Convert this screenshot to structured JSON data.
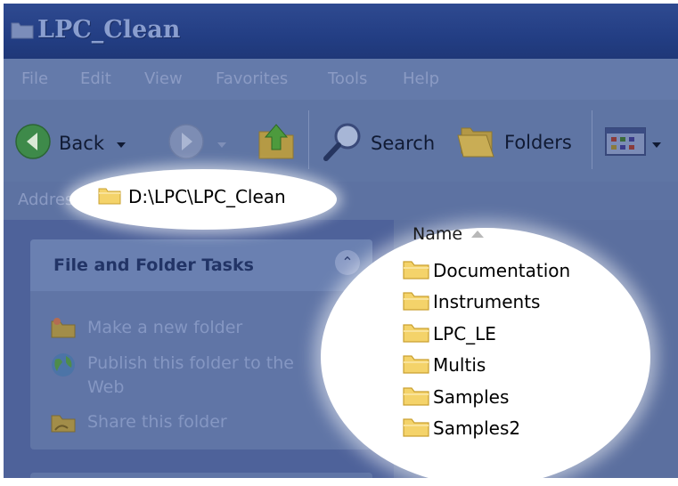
{
  "window": {
    "title": "LPC_Clean",
    "title_icon": "folder-icon"
  },
  "menu": {
    "items": [
      "File",
      "Edit",
      "View",
      "Favorites",
      "Tools",
      "Help"
    ]
  },
  "toolbar": {
    "back_label": "Back",
    "search_label": "Search",
    "folders_label": "Folders",
    "icons": [
      "back-icon",
      "forward-icon",
      "up-folder-icon",
      "search-icon",
      "folders-icon",
      "views-icon"
    ]
  },
  "address": {
    "label": "Address",
    "path": "D:\\LPC\\LPC_Clean"
  },
  "tasks_panel": {
    "title": "File and Folder Tasks",
    "tasks": [
      {
        "label": "Make a new folder",
        "icon": "new-folder-icon"
      },
      {
        "label": "Publish this folder to the Web",
        "icon": "globe-icon"
      },
      {
        "label": "Share this folder",
        "icon": "share-folder-icon"
      }
    ]
  },
  "file_list": {
    "column_name": "Name",
    "items": [
      "Documentation",
      "Instruments",
      "LPC_LE",
      "Multis",
      "Samples",
      "Samples2"
    ]
  },
  "colors": {
    "folder_yellow": "#f4d36a",
    "folder_outline": "#c9a030",
    "dim_background": "#5a6d9c",
    "highlight": "#ffffff"
  }
}
